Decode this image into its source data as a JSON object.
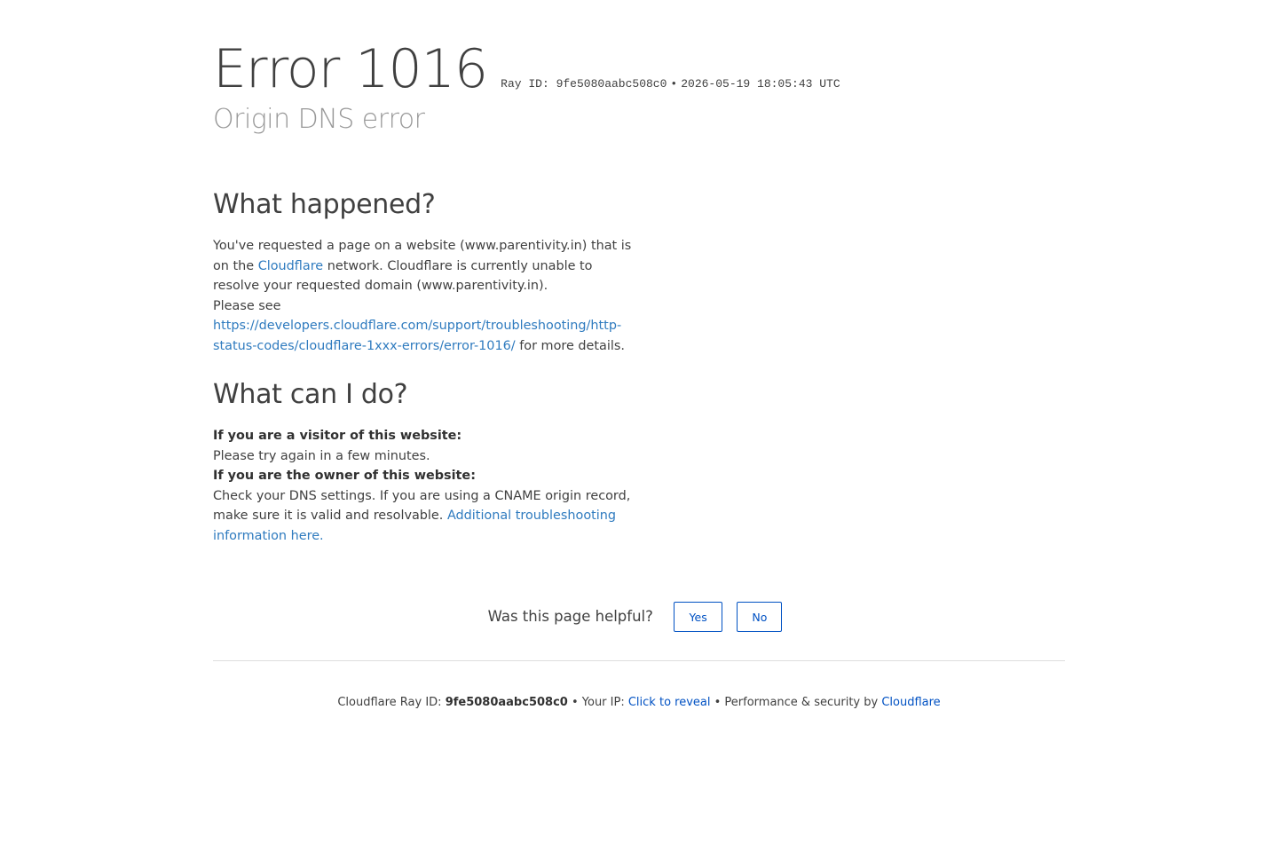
{
  "header": {
    "error_title": "Error 1016",
    "ray_id_label": "Ray ID: 9fe5080aabc508c0",
    "bullet": "•",
    "timestamp": "2026-05-19 18:05:43 UTC",
    "subtitle": "Origin DNS error"
  },
  "what_happened": {
    "heading": "What happened?",
    "text_1": "You've requested a page on a website (www.parentivity.in) that is on the ",
    "link_cloudflare": "Cloudflare",
    "text_2": " network. Cloudflare is currently unable to resolve your requested domain (www.parentivity.in).",
    "text_3": "Please see",
    "docs_link": "https://developers.cloudflare.com/support/troubleshooting/http-status-codes/cloudflare-1xxx-errors/error-1016/",
    "text_4": " for more details."
  },
  "what_can_i_do": {
    "heading": "What can I do?",
    "visitor_label": "If you are a visitor of this website:",
    "visitor_text": "Please try again in a few minutes.",
    "owner_label": "If you are the owner of this website:",
    "owner_text": "Check your DNS settings. If you are using a CNAME origin record, make sure it is valid and resolvable. ",
    "owner_link": "Additional troubleshooting information here."
  },
  "feedback": {
    "question": "Was this page helpful?",
    "yes_label": "Yes",
    "no_label": "No"
  },
  "footer": {
    "ray_prefix": "Cloudflare Ray ID: ",
    "ray_id": "9fe5080aabc508c0",
    "sep1": " • Your IP: ",
    "reveal_link": "Click to reveal",
    "sep2": " • Performance & security by ",
    "cloudflare_link": "Cloudflare"
  },
  "colors": {
    "link": "#2f7bbf",
    "button_border": "#0051c3",
    "subtitle": "#999999",
    "text": "#404040"
  }
}
